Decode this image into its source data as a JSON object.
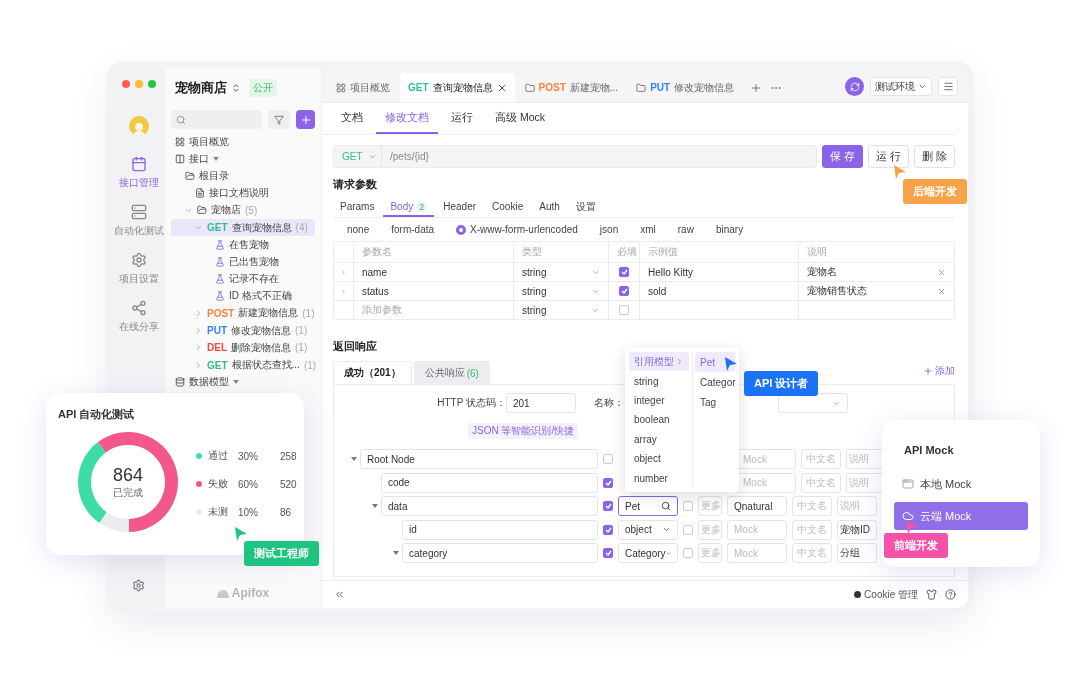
{
  "rail": {
    "items": [
      {
        "kind": "api",
        "label": "接口管理",
        "selected": true
      },
      {
        "kind": "test",
        "label": "自动化测试",
        "selected": false
      },
      {
        "kind": "settings",
        "label": "项目设置",
        "selected": false
      },
      {
        "kind": "share",
        "label": "在线分享",
        "selected": false
      }
    ]
  },
  "project": {
    "name": "宠物商店",
    "badge": "公开"
  },
  "sidebar": {
    "tree": [
      {
        "kind": "overview",
        "label": "项目概览",
        "selected": false
      },
      {
        "kind": "section",
        "label": "接口",
        "expanded": true,
        "selected": false,
        "children": [
          {
            "kind": "folder",
            "label": "根目录",
            "selected": false,
            "children": [
              {
                "kind": "doc",
                "label": "接口文档说明",
                "selected": false
              },
              {
                "kind": "folder",
                "label": "宠物店",
                "count": "(5)",
                "expanded": true,
                "selected": false,
                "children": [
                  {
                    "kind": "api",
                    "method": "GET",
                    "color": "#2fbf8f",
                    "label": "查询宠物信息",
                    "count": "(4)",
                    "expanded": true,
                    "selected": true,
                    "children": [
                      {
                        "kind": "case",
                        "label": "在售宠物",
                        "selected": false
                      },
                      {
                        "kind": "case",
                        "label": "已出售宠物",
                        "selected": false
                      },
                      {
                        "kind": "case",
                        "label": "记录不存在",
                        "selected": false
                      },
                      {
                        "kind": "case",
                        "label": "ID 格式不正确",
                        "selected": false
                      }
                    ]
                  },
                  {
                    "kind": "api",
                    "method": "POST",
                    "color": "#f5843c",
                    "label": "新建宠物信息",
                    "count": "(1)",
                    "expanded": false,
                    "selected": false
                  },
                  {
                    "kind": "api",
                    "method": "PUT",
                    "color": "#3b7ff5",
                    "label": "修改宠物信息",
                    "count": "(1)",
                    "expanded": false,
                    "selected": false
                  },
                  {
                    "kind": "api",
                    "method": "DEL",
                    "color": "#f04a3c",
                    "label": "删除宠物信息",
                    "count": "(1)",
                    "expanded": false,
                    "selected": false
                  },
                  {
                    "kind": "api",
                    "method": "GET",
                    "color": "#2fbf8f",
                    "label": "根据状态查找...",
                    "count": "(1)",
                    "expanded": false,
                    "selected": false
                  }
                ]
              }
            ]
          }
        ]
      },
      {
        "kind": "section",
        "label": "数据模型",
        "expanded": true,
        "selected": false
      }
    ],
    "logo": "Apifox"
  },
  "tabs": [
    {
      "kind": "overview",
      "label": "项目概览",
      "selected": false
    },
    {
      "kind": "api",
      "method": "GET",
      "color": "#2fbf8f",
      "label": "查询宠物信息",
      "selected": true
    },
    {
      "kind": "api",
      "method": "POST",
      "color": "#f5843c",
      "label": "新建宠物...",
      "selected": false
    },
    {
      "kind": "api",
      "method": "PUT",
      "color": "#3b7ff5",
      "label": "修改宠物信息",
      "selected": false
    }
  ],
  "environment": "测试环境",
  "doc_tabs": [
    {
      "label": "文档",
      "selected": false
    },
    {
      "label": "修改文档",
      "selected": true
    },
    {
      "label": "运行",
      "selected": false
    },
    {
      "label": "高级 Mock",
      "selected": false
    }
  ],
  "request": {
    "method": "GET",
    "path": "/pets/{id}",
    "buttons": [
      {
        "label": "保 存",
        "kind": "primary"
      },
      {
        "label": "运 行",
        "kind": "default"
      },
      {
        "label": "删 除",
        "kind": "default"
      }
    ]
  },
  "params": {
    "title": "请求参数",
    "tabs": [
      {
        "label": "Params",
        "selected": false
      },
      {
        "label": "Body",
        "count": "2",
        "selected": true
      },
      {
        "label": "Header",
        "selected": false
      },
      {
        "label": "Cookie",
        "selected": false
      },
      {
        "label": "Auth",
        "selected": false
      },
      {
        "label": "设置",
        "selected": false
      }
    ],
    "body_types": [
      {
        "label": "none",
        "selected": false
      },
      {
        "label": "form-data",
        "selected": false
      },
      {
        "label": "X-www-form-urlencoded",
        "selected": true
      },
      {
        "label": "json",
        "selected": false
      },
      {
        "label": "xml",
        "selected": false
      },
      {
        "label": "raw",
        "selected": false
      },
      {
        "label": "binary",
        "selected": false
      }
    ],
    "columns": [
      "参数名",
      "类型",
      "必填",
      "示例值",
      "说明"
    ],
    "rows": [
      {
        "name": "name",
        "type": "string",
        "required": true,
        "example": "Hello Kitty",
        "description": "宠物名"
      },
      {
        "name": "status",
        "type": "string",
        "required": true,
        "example": "sold",
        "description": "宠物销售状态"
      }
    ],
    "new_row": {
      "placeholder": "添加参数",
      "type": "string",
      "required": false
    }
  },
  "response": {
    "title": "返回响应",
    "tabs": [
      {
        "label": "成功（201）",
        "selected": true
      },
      {
        "label": "公共响应",
        "count": "(6)",
        "selected": false
      }
    ],
    "add_label": "添加",
    "status_label": "HTTP 状态码：",
    "status_value": "201",
    "name_label": "名称：",
    "import_hint": "JSON 等智能识别/快捷",
    "tree": [
      {
        "name": "Root Node",
        "required": false,
        "expanded": true,
        "mock_placeholder": "Mock",
        "title_placeholder": "中文名",
        "note_placeholder": "说明",
        "children": [
          {
            "name": "code",
            "required": true,
            "expanded": false,
            "mock_placeholder": "Mock",
            "title_placeholder": "中文名",
            "note_placeholder": "说明"
          },
          {
            "name": "data",
            "required": true,
            "expanded": true,
            "type": "Pet",
            "focused": true,
            "nullable": false,
            "more": "更多",
            "mock": "Qnatural",
            "title_placeholder": "中文名",
            "note_placeholder": "说明",
            "children": [
              {
                "name": "id",
                "required": true,
                "expanded": false,
                "type": "object",
                "focused": false,
                "nullable": false,
                "more": "更多",
                "mock_placeholder": "Mock",
                "title_placeholder": "中文名",
                "note": "宠物ID"
              },
              {
                "name": "category",
                "required": true,
                "expanded": true,
                "type": "Category",
                "focused": false,
                "nullable": false,
                "more": "更多",
                "mock_placeholder": "Mock",
                "title_placeholder": "中文名",
                "note": "分组"
              }
            ]
          }
        ]
      }
    ]
  },
  "type_menu": {
    "items": [
      {
        "label": "引用模型",
        "selected": true,
        "submenu": true
      },
      {
        "label": "string",
        "selected": false,
        "submenu": false
      },
      {
        "label": "integer",
        "selected": false,
        "submenu": false
      },
      {
        "label": "boolean",
        "selected": false,
        "submenu": false
      },
      {
        "label": "array",
        "selected": false,
        "submenu": false
      },
      {
        "label": "object",
        "selected": false,
        "submenu": false
      },
      {
        "label": "number",
        "selected": false,
        "submenu": false
      }
    ],
    "models": [
      {
        "label": "Pet",
        "selected": true
      },
      {
        "label": "Categor",
        "selected": false
      },
      {
        "label": "Tag",
        "selected": false
      }
    ]
  },
  "footer": {
    "cookie": "Cookie 管理"
  },
  "test_card": {
    "title": "API 自动化测试",
    "total": "864",
    "total_label": "已完成",
    "legend": [
      {
        "percent": "30%",
        "count": "258",
        "color": "#3ddba6"
      },
      {
        "percent": "60%",
        "count": "520",
        "color": "#f2588c"
      },
      {
        "percent": "10%",
        "count": "86",
        "color": "#ececf0"
      }
    ],
    "chart_data": {
      "type": "donut",
      "categories": [
        "通过",
        "失败",
        "未测"
      ],
      "values": [
        30,
        60,
        10
      ]
    }
  },
  "mock_card": {
    "title": "API Mock",
    "items": [
      {
        "kind": "local",
        "label": "本地 Mock",
        "selected": false
      },
      {
        "kind": "cloud",
        "label": "云端 Mock",
        "selected": true
      }
    ]
  },
  "roles": [
    {
      "label": "后端开发",
      "color": "#f8a347"
    },
    {
      "label": "API 设计者",
      "color": "#1a73f5"
    },
    {
      "label": "测试工程师",
      "color": "#1ec47f"
    },
    {
      "label": "前端开发",
      "color": "#f452a8"
    }
  ]
}
